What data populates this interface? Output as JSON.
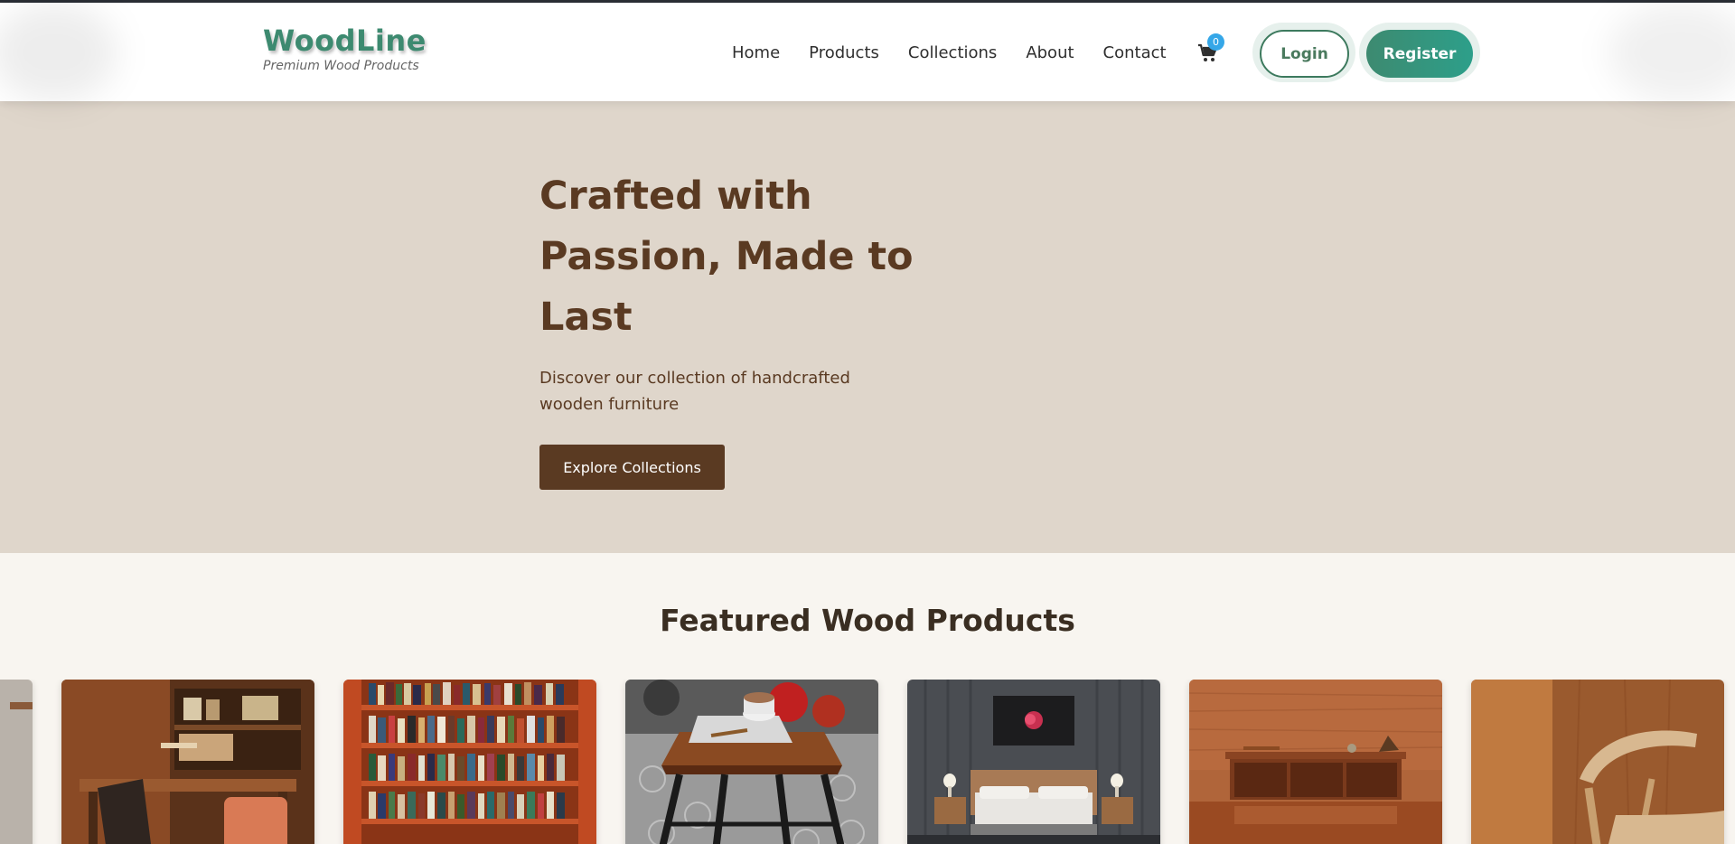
{
  "brand": {
    "name": "WoodLine",
    "tagline": "Premium Wood Products",
    "accent": "#3d8a70",
    "wood_dark": "#5a3a22"
  },
  "nav": {
    "items": [
      {
        "label": "Home"
      },
      {
        "label": "Products"
      },
      {
        "label": "Collections"
      },
      {
        "label": "About"
      },
      {
        "label": "Contact"
      }
    ],
    "cart_count": "0",
    "login_label": "Login",
    "register_label": "Register"
  },
  "hero": {
    "title": "Crafted with Passion, Made to Last",
    "subtitle": "Discover our collection of handcrafted wooden furniture",
    "cta_label": "Explore Collections"
  },
  "featured": {
    "title": "Featured Wood Products",
    "products": [
      {
        "icon": "desk-image"
      },
      {
        "icon": "bookshelf-image"
      },
      {
        "icon": "stool-image"
      },
      {
        "icon": "bed-image"
      },
      {
        "icon": "sideboard-image"
      },
      {
        "icon": "chair-image"
      }
    ]
  }
}
